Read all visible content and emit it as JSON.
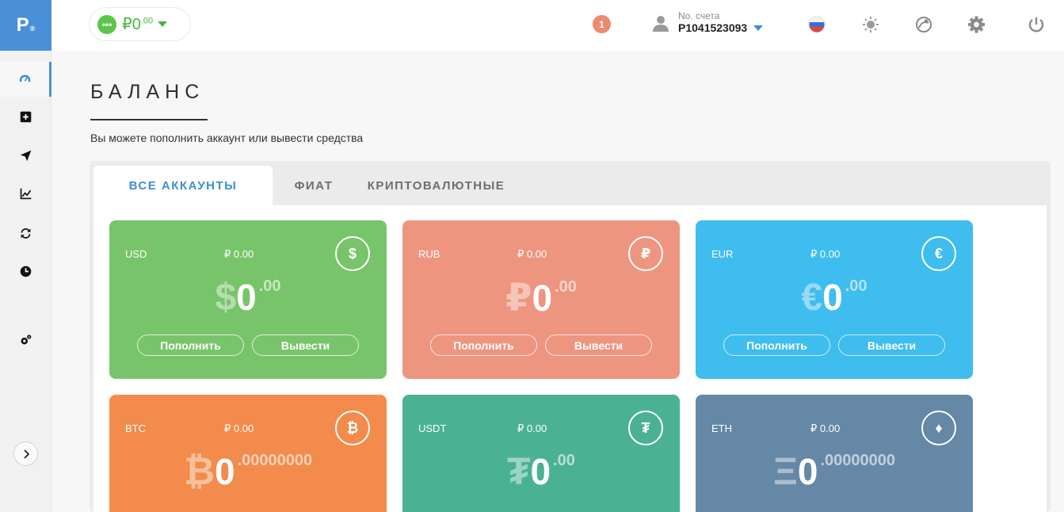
{
  "app": {
    "logo": "P",
    "logo_mark": "®"
  },
  "header": {
    "balance_prefix": "₽0",
    "balance_fraction": ".00",
    "notifications_count": "1",
    "account_label": "No. счета",
    "account_number": "P1041523093"
  },
  "page": {
    "title": "БАЛАНС",
    "subtitle": "Вы можете пополнить аккаунт или вывести средства"
  },
  "tabs": [
    {
      "label": "ВСЕ АККАУНТЫ",
      "active": true
    },
    {
      "label": "ФИАТ",
      "active": false
    },
    {
      "label": "КРИПТОВАЛЮТНЫЕ",
      "active": false
    }
  ],
  "accounts": [
    {
      "code": "USD",
      "converted": "₽ 0.00",
      "icon": "$",
      "symbol": "$",
      "int": "0",
      "fraction": ".00",
      "deposit": "Пополнить",
      "withdraw": "Вывести",
      "color": "#78c46a"
    },
    {
      "code": "RUB",
      "converted": "₽ 0.00",
      "icon": "₽",
      "symbol": "₽",
      "int": "0",
      "fraction": ".00",
      "deposit": "Пополнить",
      "withdraw": "Вывести",
      "color": "#ee9580"
    },
    {
      "code": "EUR",
      "converted": "₽ 0.00",
      "icon": "€",
      "symbol": "€",
      "int": "0",
      "fraction": ".00",
      "deposit": "Пополнить",
      "withdraw": "Вывести",
      "color": "#3fbdee"
    },
    {
      "code": "BTC",
      "converted": "₽ 0.00",
      "icon": "₿",
      "symbol": "₿",
      "int": "0",
      "fraction": ".00000000",
      "color": "#f28b4b"
    },
    {
      "code": "USDT",
      "converted": "₽ 0.00",
      "icon": "₮",
      "symbol": "₮",
      "int": "0",
      "fraction": ".00",
      "color": "#4ab292"
    },
    {
      "code": "ETH",
      "converted": "₽ 0.00",
      "icon": "♦",
      "symbol": "Ξ",
      "int": "0",
      "fraction": ".00000000",
      "color": "#6488a6"
    }
  ]
}
